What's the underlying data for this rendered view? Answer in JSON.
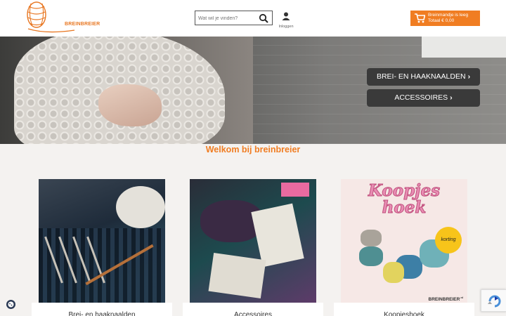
{
  "header": {
    "logo_text": "BREINBREIER",
    "search": {
      "placeholder": "Wat wil je vinden?",
      "value": ""
    },
    "login_label": "Inloggen",
    "cart": {
      "line1": "Breinmandje is leeg",
      "line2": "Totaal € 0,00"
    }
  },
  "hero": {
    "buttons": [
      {
        "label": "BREI- EN HAAKNAALDEN"
      },
      {
        "label": "ACCESSOIRES"
      }
    ]
  },
  "welcome": "Welkom bij breinbreier",
  "categories": [
    {
      "label": "Brei- en haaknaalden"
    },
    {
      "label": "Accessoires"
    },
    {
      "label": "Koopjeshoek"
    }
  ],
  "card3_image": {
    "title_line1": "Koopjes",
    "title_line2": "hoek",
    "badge": "korting",
    "brand": "BREINBREIER"
  },
  "colors": {
    "brand_orange": "#f07d22",
    "button_dark": "#3a3a3a",
    "page_bg": "#f4f2f0"
  },
  "icons": [
    "search-icon",
    "user-icon",
    "cart-icon",
    "chevron-right-icon",
    "cookie-icon",
    "recaptcha-icon"
  ]
}
